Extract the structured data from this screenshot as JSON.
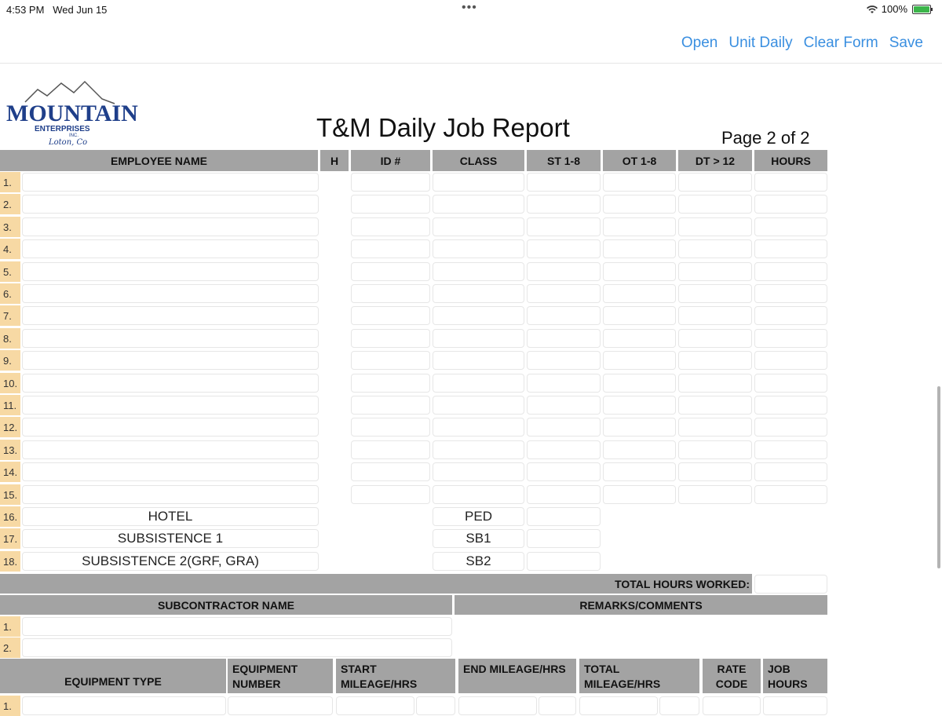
{
  "status": {
    "time": "4:53 PM",
    "date": "Wed Jun 15",
    "battery": "100%"
  },
  "nav": {
    "open": "Open",
    "unit_daily": "Unit Daily",
    "clear_form": "Clear Form",
    "save": "Save"
  },
  "logo": {
    "name": "MOUNTAIN",
    "sub": "ENTERPRISES",
    "inc": "INC.",
    "script": "Loton, Co"
  },
  "report": {
    "title": "T&M Daily Job Report",
    "page": "Page 2 of 2"
  },
  "employee_headers": {
    "name": "EMPLOYEE NAME",
    "h": "H",
    "id": "ID #",
    "class": "CLASS",
    "st": "ST 1-8",
    "ot": "OT 1-8",
    "dt": "DT > 12",
    "hours": "HOURS"
  },
  "row_numbers": [
    "1.",
    "2.",
    "3.",
    "4.",
    "5.",
    "6.",
    "7.",
    "8.",
    "9.",
    "10.",
    "11.",
    "12.",
    "13.",
    "14.",
    "15.",
    "16.",
    "17.",
    "18."
  ],
  "extra_rows": [
    {
      "label": "HOTEL",
      "code": "PED"
    },
    {
      "label": "SUBSISTENCE 1",
      "code": "SB1"
    },
    {
      "label": "SUBSISTENCE 2(GRF, GRA)",
      "code": "SB2"
    }
  ],
  "total_hours_label": "TOTAL HOURS WORKED:",
  "sub_headers": {
    "name": "SUBCONTRACTOR NAME",
    "remarks": "REMARKS/COMMENTS"
  },
  "sub_rows": [
    "1.",
    "2."
  ],
  "equipment_headers": {
    "type": "EQUIPMENT TYPE",
    "number": "EQUIPMENT NUMBER",
    "start": "START MILEAGE/HRS",
    "end": "END MILEAGE/HRS",
    "total": "TOTAL MILEAGE/HRS",
    "rate": "RATE CODE",
    "job": "JOB HOURS"
  },
  "equipment_rows": [
    "1."
  ],
  "colors": {
    "accent": "#3a8fe0",
    "header_gray": "#a3a3a3",
    "row_number_bg": "#f7d9a4",
    "logo_blue": "#1f3f8a"
  }
}
